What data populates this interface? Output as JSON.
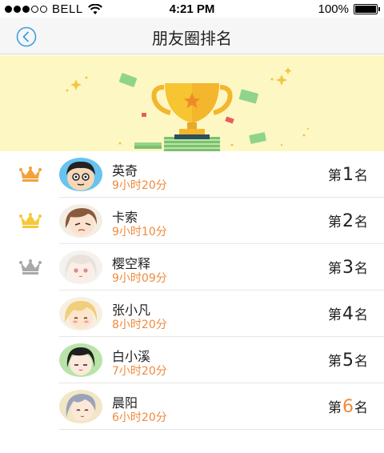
{
  "status_bar": {
    "carrier": "BELL",
    "time": "4:21 PM",
    "battery": "100%"
  },
  "nav": {
    "title": "朋友圈排名"
  },
  "rankings": [
    {
      "name": "英奇",
      "duration": "9小时20分",
      "rank_prefix": "第",
      "rank": "1",
      "rank_suffix": "名",
      "crown": "gold-crown-icon"
    },
    {
      "name": "卡索",
      "duration": "9小时10分",
      "rank_prefix": "第",
      "rank": "2",
      "rank_suffix": "名",
      "crown": "yellow-crown-icon"
    },
    {
      "name": "樱空释",
      "duration": "9小时09分",
      "rank_prefix": "第",
      "rank": "3",
      "rank_suffix": "名",
      "crown": "silver-crown-icon"
    },
    {
      "name": "张小凡",
      "duration": "8小时20分",
      "rank_prefix": "第",
      "rank": "4",
      "rank_suffix": "名"
    },
    {
      "name": "白小溪",
      "duration": "7小时20分",
      "rank_prefix": "第",
      "rank": "5",
      "rank_suffix": "名"
    },
    {
      "name": "晨阳",
      "duration": "6小时20分",
      "rank_prefix": "第",
      "rank": "6",
      "rank_suffix": "名"
    }
  ],
  "colors": {
    "accent": "#f08a3c",
    "nav_icon": "#3aa0e0",
    "banner_bg": "#fdf7c4",
    "gold_crown": "#f2a23a",
    "yellow_crown": "#f3c93a",
    "silver_crown": "#a9a9a9"
  }
}
